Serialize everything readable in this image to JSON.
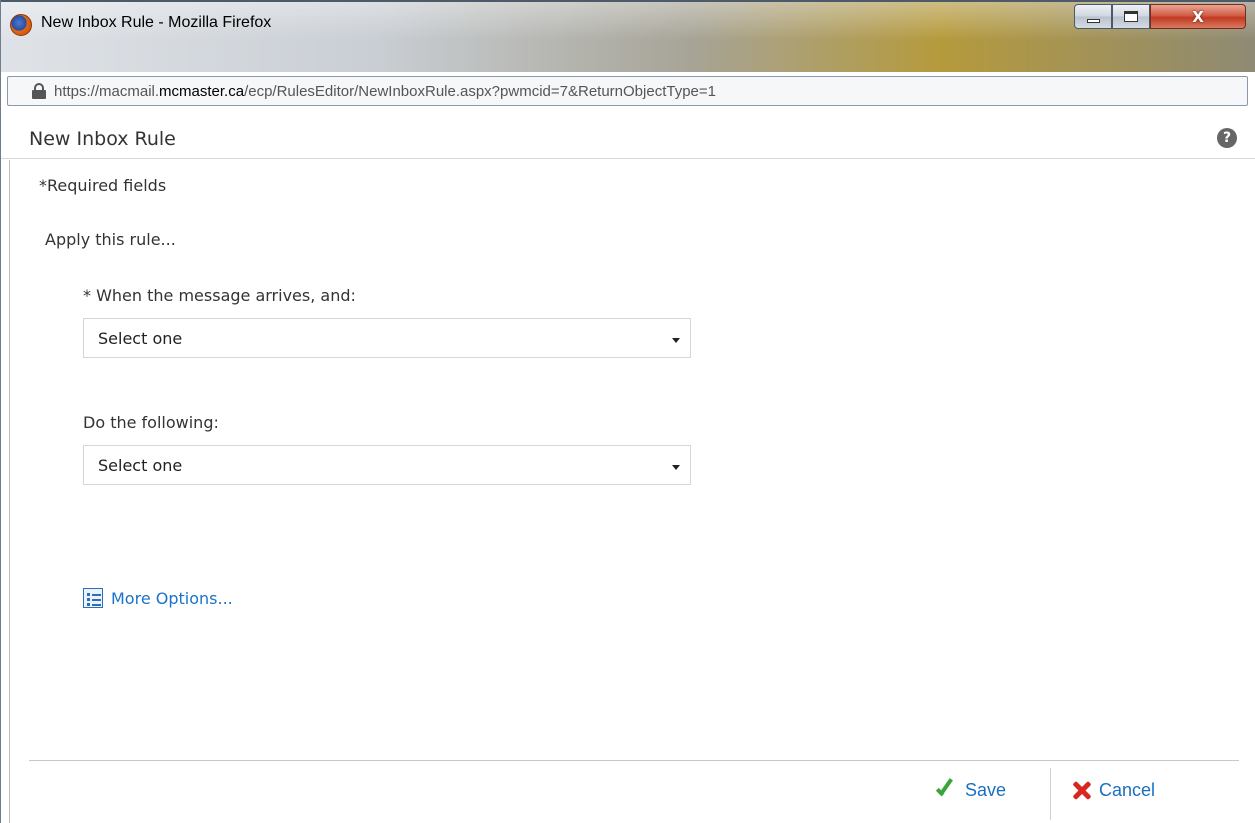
{
  "window": {
    "title": "New Inbox Rule - Mozilla Firefox",
    "minimize_icon": "minimize-icon",
    "maximize_icon": "maximize-icon",
    "close_glyph": "X"
  },
  "address_bar": {
    "url_prefix": "https://macmail.",
    "url_host": "mcmaster.ca",
    "url_suffix": "/ecp/RulesEditor/NewInboxRule.aspx?pwmcid=7&ReturnObjectType=1"
  },
  "page": {
    "title": "New Inbox Rule",
    "help_glyph": "?"
  },
  "form": {
    "required_note": "*Required fields",
    "apply_rule_label": "Apply this rule...",
    "condition": {
      "label": "* When the message arrives, and:",
      "value": "Select one"
    },
    "action": {
      "label": "Do the following:",
      "value": "Select one"
    },
    "more_options": "More Options..."
  },
  "footer": {
    "save_label": "Save",
    "cancel_label": "Cancel"
  },
  "colors": {
    "link": "#1a73c8",
    "save_check": "#3aa53a",
    "cancel_x": "#d6281e"
  }
}
